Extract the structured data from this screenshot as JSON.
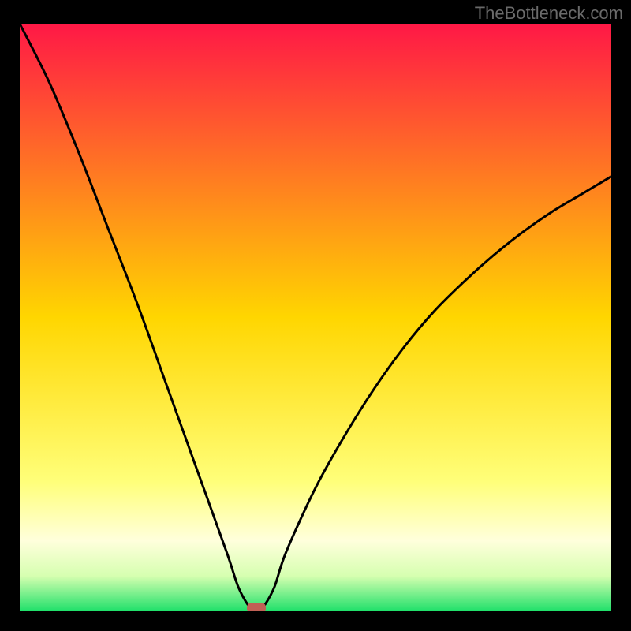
{
  "attribution": "TheBottleneck.com",
  "chart_data": {
    "type": "line",
    "title": "",
    "xlabel": "",
    "ylabel": "",
    "xlim": [
      0,
      100
    ],
    "ylim": [
      0,
      100
    ],
    "x": [
      0,
      5,
      10,
      15,
      20,
      25,
      30,
      35,
      37,
      39,
      40,
      41,
      43,
      45,
      50,
      55,
      60,
      65,
      70,
      75,
      80,
      85,
      90,
      95,
      100
    ],
    "values": [
      100,
      90,
      78,
      65,
      52,
      38,
      24,
      10,
      4,
      0.5,
      0,
      0.5,
      4,
      10,
      21,
      30,
      38,
      45,
      51,
      56,
      60.5,
      64.5,
      68,
      71,
      74
    ],
    "optimum_x": 40,
    "marker": {
      "shape": "rounded-rect",
      "x": 40,
      "y": 0,
      "color": "#c06055"
    },
    "background_gradient": {
      "stops": [
        {
          "offset": 0,
          "color": "#ff1846"
        },
        {
          "offset": 50,
          "color": "#ffd600"
        },
        {
          "offset": 78,
          "color": "#ffff7a"
        },
        {
          "offset": 88,
          "color": "#ffffdc"
        },
        {
          "offset": 94,
          "color": "#d6ffb0"
        },
        {
          "offset": 100,
          "color": "#1fe06a"
        }
      ]
    }
  }
}
